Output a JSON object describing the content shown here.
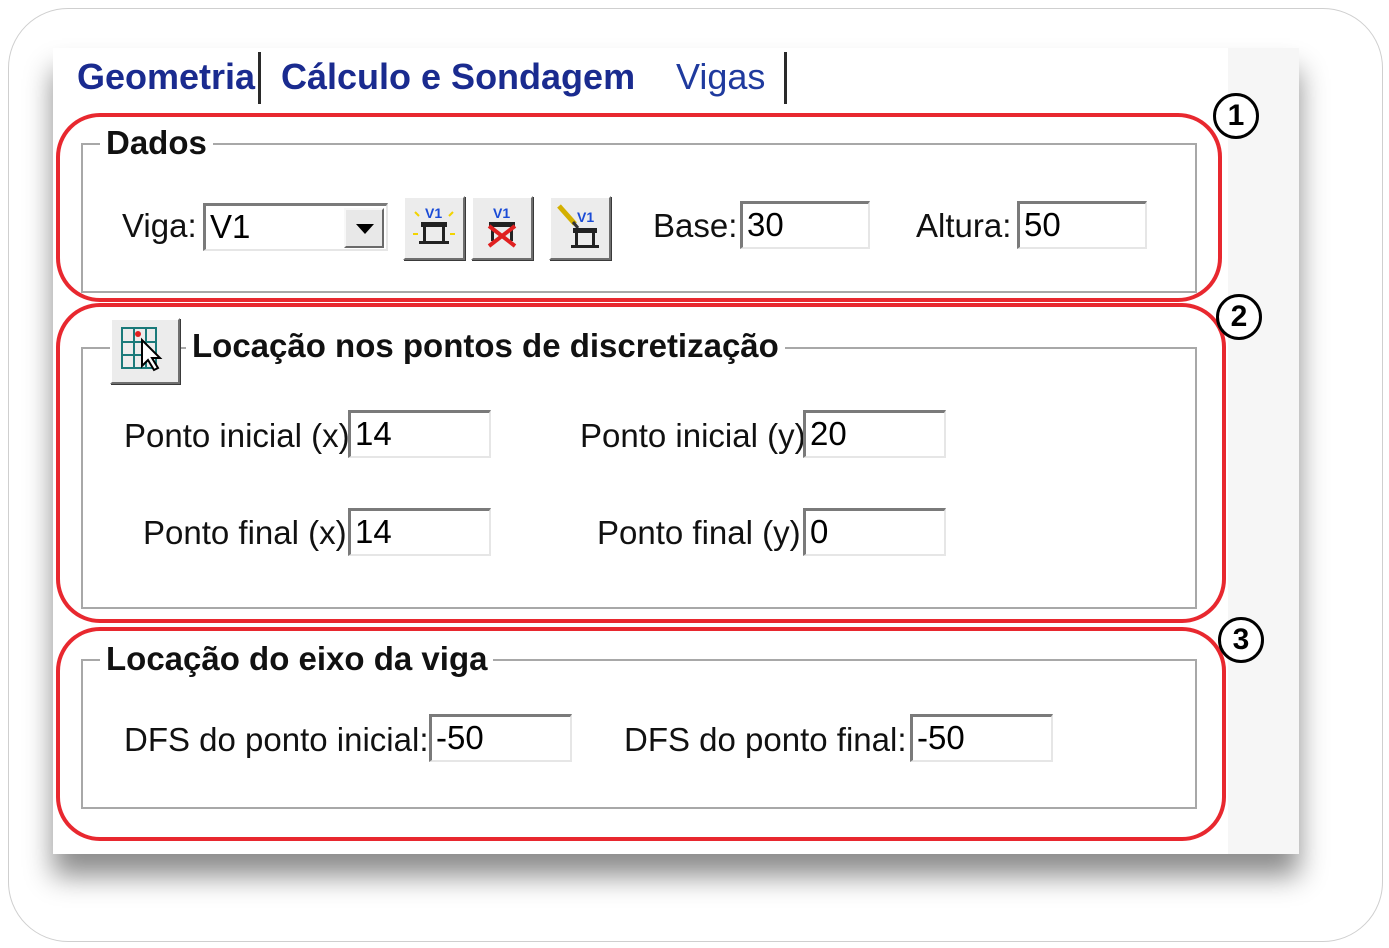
{
  "tabs": [
    {
      "label": "Geometria",
      "active": false
    },
    {
      "label": "Cálculo e Sondagem",
      "active": false
    },
    {
      "label": "Vigas",
      "active": true
    }
  ],
  "dados": {
    "title": "Dados",
    "viga_label": "Viga:",
    "viga_value": "V1",
    "button_icons": [
      "add-beam-icon",
      "delete-beam-icon",
      "edit-beam-icon"
    ],
    "icon_text": "V1",
    "base_label": "Base:",
    "base_value": "30",
    "altura_label": "Altura:",
    "altura_value": "50"
  },
  "locacao_pontos": {
    "title": "Locação nos pontos de discretização",
    "ponto_inicial_x_label": "Ponto inicial (x):",
    "ponto_inicial_x_value": "14",
    "ponto_inicial_y_label": "Ponto inicial (y):",
    "ponto_inicial_y_value": "20",
    "ponto_final_x_label": "Ponto final (x):",
    "ponto_final_x_value": "14",
    "ponto_final_y_label": "Ponto final (y):",
    "ponto_final_y_value": "0"
  },
  "locacao_eixo": {
    "title": "Locação do eixo da viga",
    "dfs_inicial_label": "DFS do ponto inicial:",
    "dfs_inicial_value": "-50",
    "dfs_final_label": "DFS do ponto final:",
    "dfs_final_value": "-50"
  },
  "annotations": [
    "1",
    "2",
    "3"
  ],
  "colors": {
    "annotation": "#e8282f",
    "tab_text": "#1a2b8f"
  }
}
